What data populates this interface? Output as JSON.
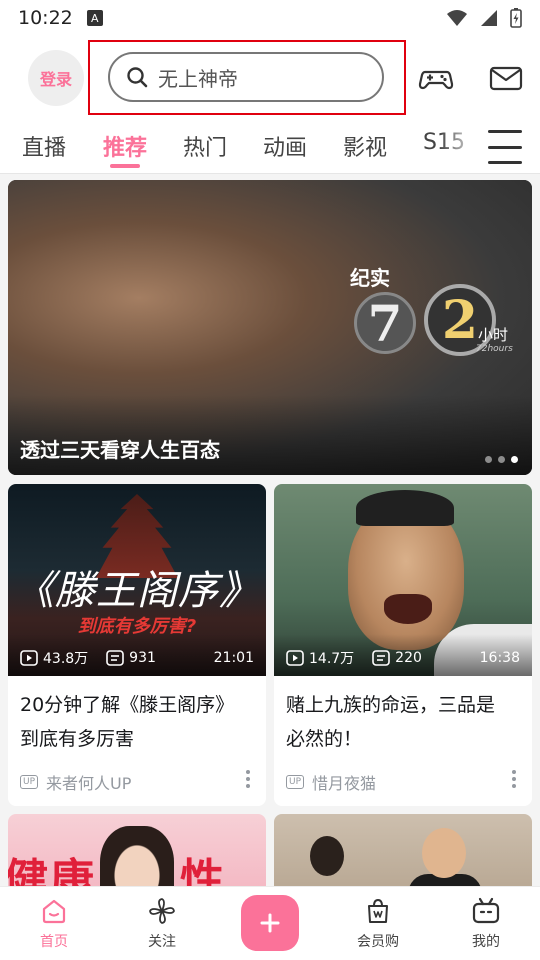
{
  "status_bar": {
    "time": "10:22",
    "indicator": "A"
  },
  "header": {
    "login_label": "登录",
    "search_placeholder": "无上神帝"
  },
  "tabs": [
    {
      "label": "直播",
      "active": false
    },
    {
      "label": "推荐",
      "active": true
    },
    {
      "label": "热门",
      "active": false
    },
    {
      "label": "动画",
      "active": false
    },
    {
      "label": "影视",
      "active": false
    },
    {
      "label": "S15",
      "active": false
    }
  ],
  "banner": {
    "caption": "透过三天看穿人生百态",
    "badge_label": "纪实",
    "badge_digit_1": "7",
    "badge_digit_2": "2",
    "badge_unit": "小时",
    "badge_unit_en": "72hours",
    "dots_total": 3,
    "active_dot": 3
  },
  "cards": [
    {
      "thumb_title": "《滕王阁序》",
      "thumb_subtitle": "到底有多厉害?",
      "views": "43.8万",
      "danmaku": "931",
      "duration": "21:01",
      "title_line1": "20分钟了解《滕王阁序》",
      "title_line2": "到底有多厉害",
      "up_badge": "UP",
      "uploader": "来者何人UP"
    },
    {
      "views": "14.7万",
      "danmaku": "220",
      "duration": "16:38",
      "title_line1": "赌上九族的命运，三品是",
      "title_line2": "必然的！",
      "up_badge": "UP",
      "uploader": "惜月夜猫"
    }
  ],
  "partial_cards": [
    {
      "thumb_text": "健康",
      "thumb_text_2": "性爱"
    },
    {}
  ],
  "bottom_nav": [
    {
      "label": "首页",
      "active": true,
      "icon": "home-icon"
    },
    {
      "label": "关注",
      "active": false,
      "icon": "pinwheel-icon"
    },
    {
      "label": "",
      "icon": "plus-icon"
    },
    {
      "label": "会员购",
      "active": false,
      "icon": "shopping-bag-icon"
    },
    {
      "label": "我的",
      "active": false,
      "icon": "tv-icon"
    }
  ],
  "colors": {
    "brand_pink": "#fb7299",
    "highlight_red": "#e0000f"
  }
}
